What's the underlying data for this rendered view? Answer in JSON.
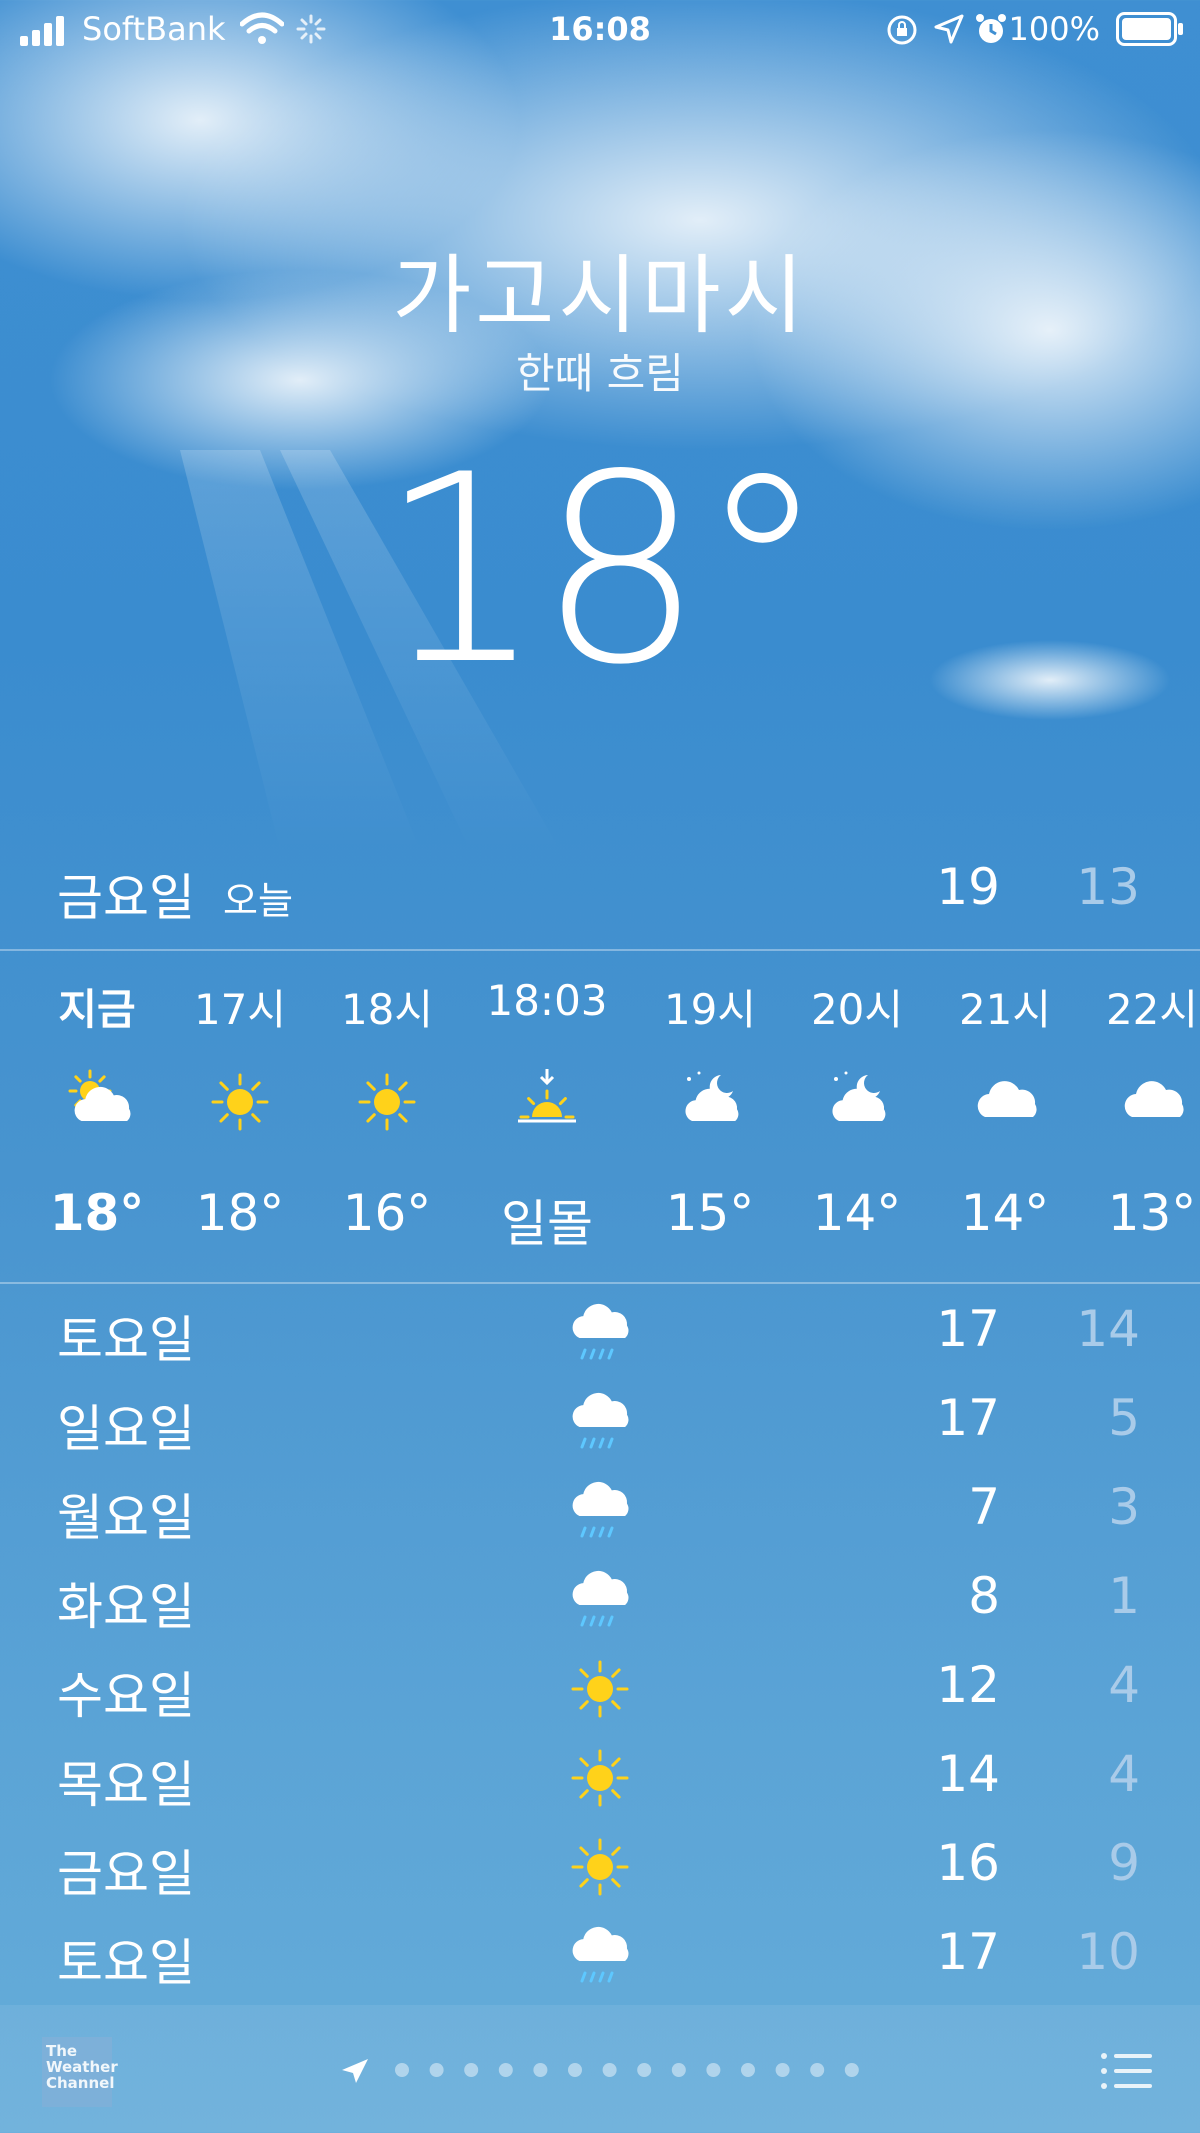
{
  "status": {
    "carrier": "SoftBank",
    "time": "16:08",
    "battery": "100%"
  },
  "location": {
    "city": "가고시마시",
    "condition": "한때 흐림",
    "temperature": "18°"
  },
  "today": {
    "day": "금요일",
    "label": "오늘",
    "high": "19",
    "low": "13"
  },
  "hourly": [
    {
      "label": "지금",
      "icon": "partly-sunny-icon",
      "temp": "18°",
      "bold": true
    },
    {
      "label": "17시",
      "icon": "sun-icon",
      "temp": "18°"
    },
    {
      "label": "18시",
      "icon": "sun-icon",
      "temp": "16°"
    },
    {
      "label": "18:03",
      "icon": "sunset-icon",
      "temp": "일몰"
    },
    {
      "label": "19시",
      "icon": "partly-cloudy-night-icon",
      "temp": "15°"
    },
    {
      "label": "20시",
      "icon": "partly-cloudy-night-icon",
      "temp": "14°"
    },
    {
      "label": "21시",
      "icon": "cloud-icon",
      "temp": "14°"
    },
    {
      "label": "22시",
      "icon": "cloud-icon",
      "temp": "13°"
    }
  ],
  "daily": [
    {
      "day": "토요일",
      "icon": "rain-icon",
      "high": "17",
      "low": "14"
    },
    {
      "day": "일요일",
      "icon": "rain-icon",
      "high": "17",
      "low": "5"
    },
    {
      "day": "월요일",
      "icon": "rain-icon",
      "high": "7",
      "low": "3"
    },
    {
      "day": "화요일",
      "icon": "rain-icon",
      "high": "8",
      "low": "1"
    },
    {
      "day": "수요일",
      "icon": "sun-icon",
      "high": "12",
      "low": "4"
    },
    {
      "day": "목요일",
      "icon": "sun-icon",
      "high": "14",
      "low": "4"
    },
    {
      "day": "금요일",
      "icon": "sun-icon",
      "high": "16",
      "low": "9"
    },
    {
      "day": "토요일",
      "icon": "rain-icon",
      "high": "17",
      "low": "10"
    }
  ],
  "footer": {
    "provider": "The Weather Channel",
    "page_dots": 14
  },
  "colors": {
    "sky_top": "#3f8fd2",
    "sky_bottom": "#66add9",
    "low_temp": "#a9cbe9",
    "sun": "#ffd21a"
  }
}
